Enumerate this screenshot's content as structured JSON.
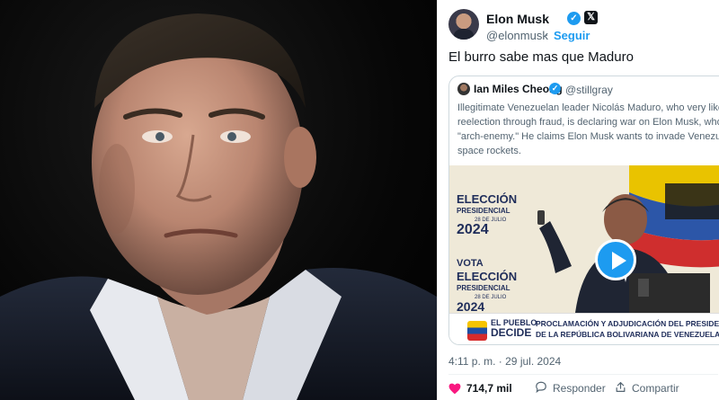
{
  "tweet": {
    "author_name": "Elon Musk",
    "author_handle": "@elonmusk",
    "separator": "·",
    "follow_label": "Seguir",
    "verified_mark": "✓",
    "x_logo": "𝕏",
    "text": "El burro sabe mas que Maduro",
    "timestamp": "4:11 p. m. · 29 jul. 2024",
    "actions": {
      "likes": "714,7 mil",
      "reply_label": "Responder",
      "share_label": "Compartir"
    }
  },
  "quoted": {
    "author_name": "Ian Miles Cheong",
    "author_handle": "@stillgray",
    "verified_mark": "✓",
    "lines": [
      "Illegitimate Venezuelan leader Nicolás Maduro, who very likely",
      "reelection through fraud, is declaring war on Elon Musk, whom",
      "\"arch-enemy.\" He claims Elon Musk wants to invade Venezuela",
      "space rockets."
    ],
    "video": {
      "banner_logo_top": "EL PUEBLO",
      "banner_logo_bottom": "DECIDE",
      "banner_line1": "PROCLAMACIÓN Y ADJUDICACIÓN DEL PRESIDENTE CON",
      "banner_line2": "DE LA REPÚBLICA BOLIVARIANA DE VENEZUELA NICOLA",
      "backdrop_text_1": "ELECCIÓN",
      "backdrop_text_2": "PRESIDENCIAL",
      "backdrop_text_3": "28 DE JULIO",
      "backdrop_year": "2024",
      "backdrop_text_4": "VOTA",
      "backdrop_text_5": "ELECCIÓN",
      "backdrop_text_6": "PRESIDENCIAL",
      "backdrop_text_7": "28 DE JULIO",
      "backdrop_year_2": "2024"
    }
  },
  "colors": {
    "accent": "#1d9bf0",
    "text_primary": "#0f1419",
    "text_secondary": "#536471",
    "like": "#f91880"
  },
  "icons": {
    "like": "heart-icon",
    "reply": "reply-icon",
    "share": "share-icon",
    "play": "play-icon"
  }
}
